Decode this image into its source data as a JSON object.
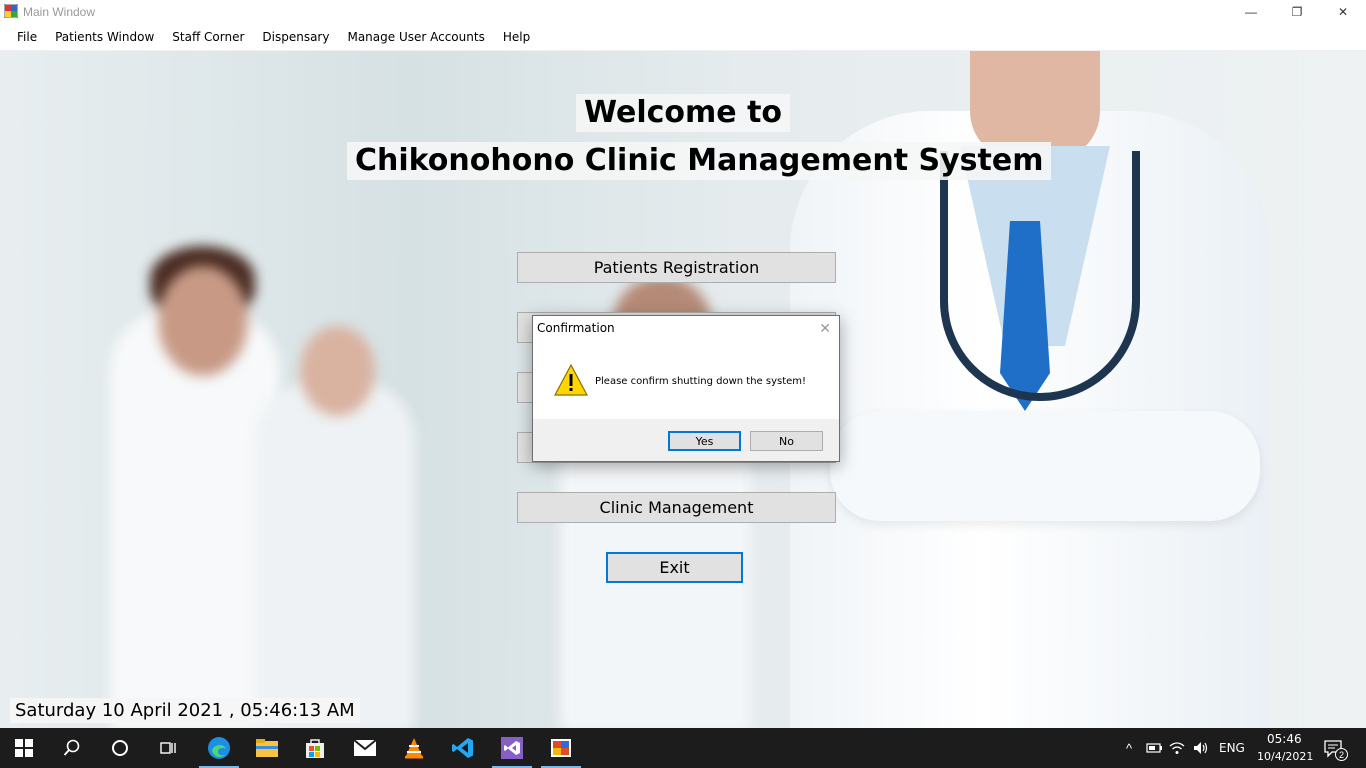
{
  "window": {
    "title": "Main Window",
    "minimize": "—",
    "maximize": "❐",
    "close": "✕"
  },
  "menu": {
    "items": [
      "File",
      "Patients Window",
      "Staff Corner",
      "Dispensary",
      "Manage User Accounts",
      "Help"
    ]
  },
  "main": {
    "welcome_line1": "Welcome to",
    "welcome_line2": "Chikonohono Clinic Management System",
    "buttons": {
      "patients_registration": "Patients Registration",
      "clinic_management": "Clinic Management",
      "exit": "Exit"
    },
    "datetime": "Saturday 10 April 2021 , 05:46:13 AM"
  },
  "dialog": {
    "title": "Confirmation",
    "close": "✕",
    "message": "Please confirm shutting down the system!",
    "icon": "warning-icon",
    "yes": "Yes",
    "no": "No"
  },
  "taskbar": {
    "apps": [
      "windows-start-icon",
      "search-icon",
      "cortana-icon",
      "task-view-icon",
      "edge-icon",
      "file-explorer-icon",
      "store-icon",
      "mail-icon",
      "vlc-icon",
      "vscode-icon",
      "visual-studio-icon",
      "app-icon"
    ],
    "language": "ENG",
    "time": "05:46",
    "date": "10/4/2021",
    "notification_count": "2"
  },
  "colors": {
    "accent": "#0078d7",
    "taskbar": "#1c1c1c",
    "button": "#e1e1e1"
  }
}
